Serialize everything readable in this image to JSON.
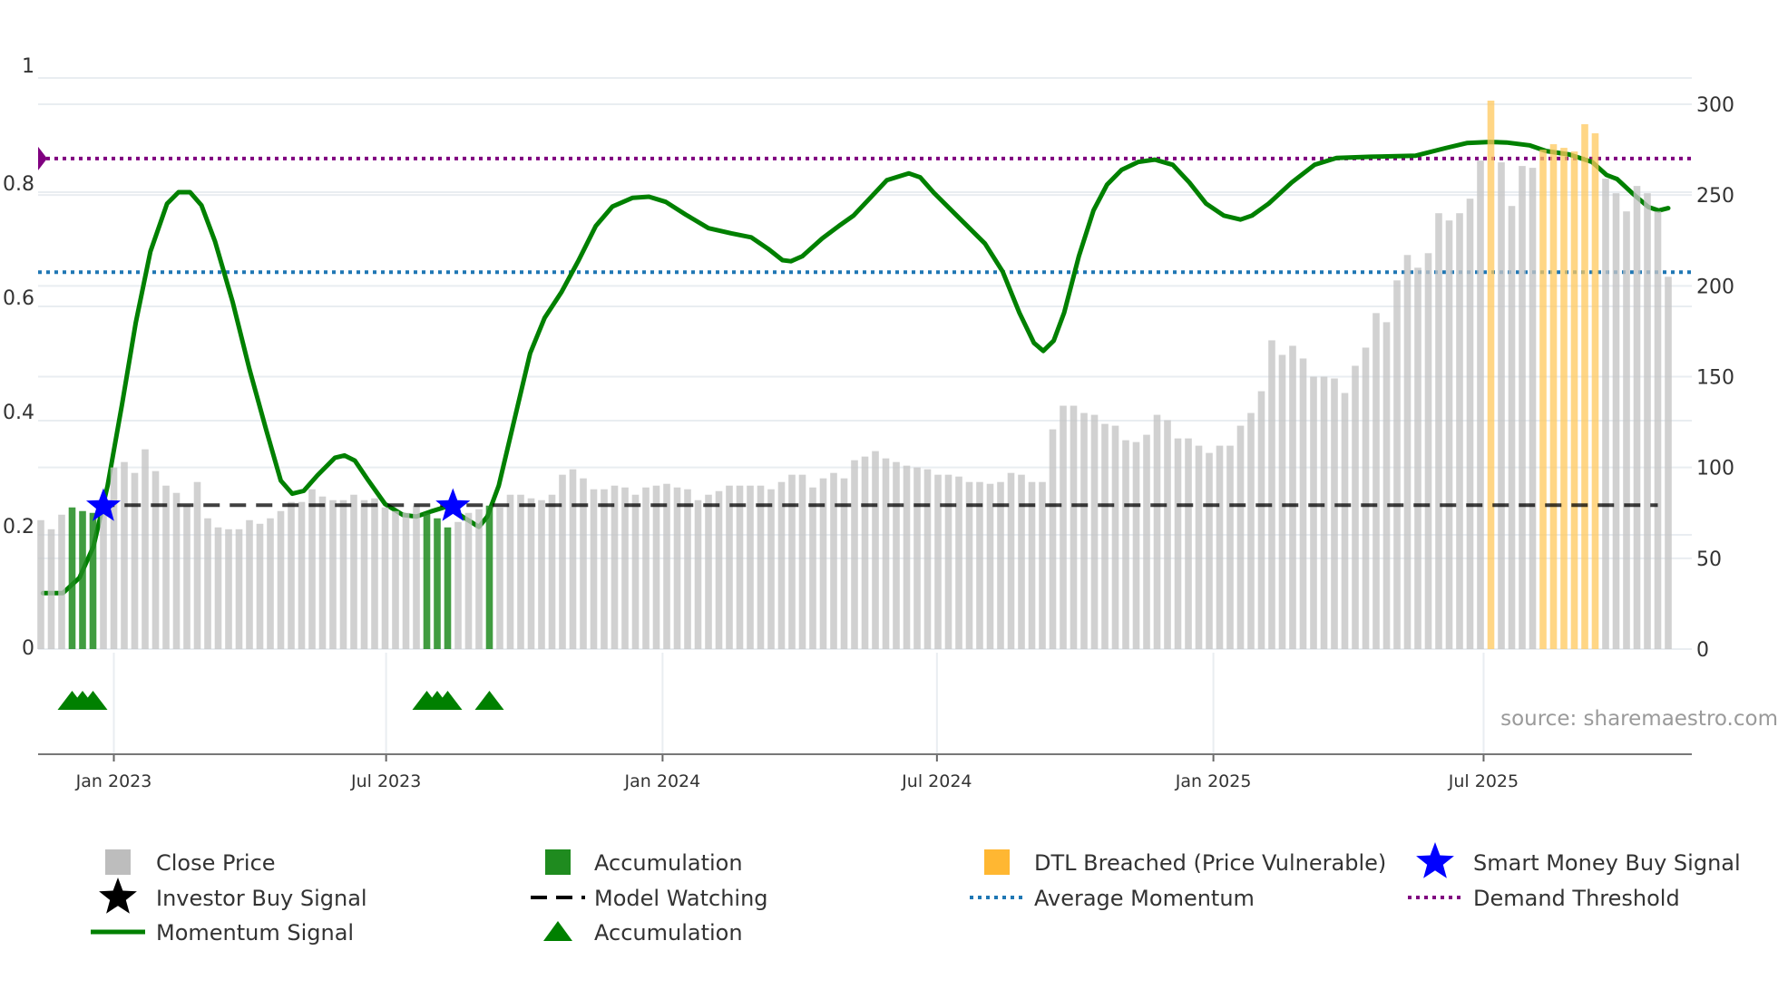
{
  "chart_data": {
    "type": "bar",
    "title": "",
    "x_start": "2022-11-13",
    "x_interval": "week",
    "left_axis": {
      "label": "",
      "ylim": [
        0,
        1
      ],
      "ticks": [
        "0",
        "0.2",
        "0.4",
        "0.6",
        "0.8",
        "1"
      ]
    },
    "right_axis": {
      "label": "",
      "ylim": [
        0,
        300
      ],
      "ticks": [
        "0",
        "50",
        "100",
        "150",
        "200",
        "250",
        "300"
      ]
    },
    "x_ticks": [
      "Jan 2023",
      "Jul 2023",
      "Jan 2024",
      "Jul 2024",
      "Jan 2025",
      "Jul 2025"
    ],
    "x_tick_weeks": [
      7,
      33.1,
      59.6,
      85.9,
      112.4,
      138.3
    ],
    "close_price": [
      71,
      66,
      74,
      78,
      76,
      75,
      76,
      100,
      103,
      97,
      110,
      98,
      90,
      86,
      79,
      92,
      72,
      67,
      66,
      66,
      71,
      69,
      72,
      76,
      81,
      81,
      88,
      84,
      82,
      82,
      85,
      82,
      83,
      78,
      76,
      75,
      79,
      75,
      72,
      67,
      70,
      75,
      77,
      79,
      78,
      85,
      85,
      83,
      82,
      85,
      96,
      99,
      94,
      88,
      88,
      90,
      89,
      85,
      89,
      90,
      91,
      89,
      88,
      82,
      85,
      87,
      90,
      90,
      90,
      90,
      88,
      92,
      96,
      96,
      89,
      94,
      97,
      94,
      104,
      106,
      109,
      105,
      103,
      101,
      100,
      99,
      96,
      96,
      95,
      92,
      92,
      91,
      92,
      97,
      96,
      92,
      92,
      121,
      134,
      134,
      130,
      129,
      124,
      123,
      115,
      114,
      118,
      129,
      126,
      116,
      116,
      112,
      108,
      112,
      112,
      123,
      130,
      142,
      170,
      162,
      167,
      160,
      150,
      150,
      149,
      141,
      156,
      166,
      185,
      180,
      203,
      217,
      210,
      218,
      240,
      236,
      240,
      248,
      269,
      302,
      268,
      244,
      266,
      265,
      275,
      278,
      276,
      274,
      289,
      284,
      259,
      251,
      241,
      255,
      251,
      241,
      205
    ],
    "accumulation_weeks": [
      3,
      4,
      5,
      37,
      38,
      39,
      43
    ],
    "dtl_breached_weeks": [
      139,
      144,
      145,
      146,
      147,
      148,
      149
    ],
    "momentum": {
      "weeks": [
        0.2,
        2.1,
        3.7,
        5.05,
        6.4,
        7.8,
        9.1,
        10.5,
        12.1,
        13.2,
        14.3,
        15.4,
        16.7,
        18.4,
        20,
        21.6,
        23,
        24.1,
        25.2,
        26.5,
        28.2,
        29.1,
        30.1,
        31.4,
        33,
        34.7,
        36,
        37.4,
        39,
        40.4,
        42,
        42.8,
        43.9,
        45.5,
        46.9,
        48.3,
        49.9,
        51.5,
        53.2,
        54.8,
        56.7,
        58.3,
        59.9,
        61.8,
        64,
        66.2,
        68.1,
        69.7,
        71.1,
        71.9,
        73,
        74.9,
        76.5,
        77.9,
        79.5,
        81.1,
        83.2,
        84.3,
        85.6,
        87.8,
        90.5,
        92.2,
        93.8,
        95.2,
        96.1,
        97.1,
        98.1,
        99.5,
        100.9,
        102.2,
        103.6,
        105.2,
        106.8,
        108.5,
        110.1,
        111.7,
        113.4,
        115,
        116.1,
        117.7,
        119.9,
        122.1,
        124.2,
        127.5,
        131.8,
        134.6,
        136.7,
        138.9,
        140.5,
        142.7,
        144.3,
        146.5,
        148.7,
        150.1,
        151.1,
        152.5,
        154.1,
        155.1,
        156
      ],
      "values": [
        0.098,
        0.098,
        0.125,
        0.18,
        0.286,
        0.43,
        0.571,
        0.696,
        0.78,
        0.8,
        0.8,
        0.777,
        0.714,
        0.607,
        0.49,
        0.384,
        0.295,
        0.272,
        0.277,
        0.304,
        0.335,
        0.339,
        0.33,
        0.295,
        0.254,
        0.235,
        0.232,
        0.241,
        0.25,
        0.232,
        0.214,
        0.232,
        0.286,
        0.41,
        0.518,
        0.58,
        0.625,
        0.679,
        0.741,
        0.775,
        0.79,
        0.792,
        0.783,
        0.761,
        0.737,
        0.728,
        0.721,
        0.701,
        0.681,
        0.679,
        0.688,
        0.719,
        0.741,
        0.759,
        0.79,
        0.821,
        0.833,
        0.826,
        0.799,
        0.759,
        0.71,
        0.661,
        0.589,
        0.536,
        0.522,
        0.54,
        0.589,
        0.688,
        0.768,
        0.813,
        0.839,
        0.853,
        0.857,
        0.848,
        0.817,
        0.78,
        0.759,
        0.752,
        0.759,
        0.78,
        0.817,
        0.848,
        0.86,
        0.862,
        0.864,
        0.877,
        0.886,
        0.888,
        0.887,
        0.882,
        0.872,
        0.866,
        0.853,
        0.83,
        0.823,
        0.799,
        0.774,
        0.768,
        0.772
      ]
    },
    "model_watching": 0.252,
    "average_momentum": 0.66,
    "demand_threshold": 0.859,
    "smart_money_buy_signals": [
      {
        "week": 6,
        "value": 0.25
      },
      {
        "week": 39.5,
        "value": 0.25
      }
    ],
    "investor_buy_signals": [],
    "accumulation_markers_weeks": [
      3,
      4,
      5,
      37,
      38,
      39,
      43
    ],
    "source": "source: sharemaestro.com",
    "legend": {
      "placement": "bottom",
      "items": [
        {
          "label": "Close Price",
          "marker": "square",
          "color": "#bdbdbd"
        },
        {
          "label": "Accumulation",
          "marker": "square",
          "color": "#1f8b1f"
        },
        {
          "label": "DTL Breached (Price Vulnerable)",
          "marker": "square",
          "color": "#ffb732"
        },
        {
          "label": "Smart Money Buy Signal",
          "marker": "star",
          "color": "#0000ff"
        },
        {
          "label": "Investor Buy Signal",
          "marker": "star",
          "color": "#000000"
        },
        {
          "label": "Model Watching",
          "marker": "dashed",
          "color": "#000000"
        },
        {
          "label": "Average Momentum",
          "marker": "dotted",
          "color": "#1f77b4"
        },
        {
          "label": "Demand Threshold",
          "marker": "dotted",
          "color": "#800080"
        },
        {
          "label": "Momentum Signal",
          "marker": "line",
          "color": "#008000"
        },
        {
          "label": "Accumulation",
          "marker": "triangle",
          "color": "#008000"
        }
      ]
    },
    "colors": {
      "price": "#c4c4c4",
      "accumulation": "#1f8b1f",
      "dtl": "#ffc85c",
      "momentum": "#008000",
      "threshold": "#800080",
      "average": "#1f77b4",
      "watching": "#000000",
      "star": "#0000ff",
      "grid": "#e9edf1"
    }
  }
}
